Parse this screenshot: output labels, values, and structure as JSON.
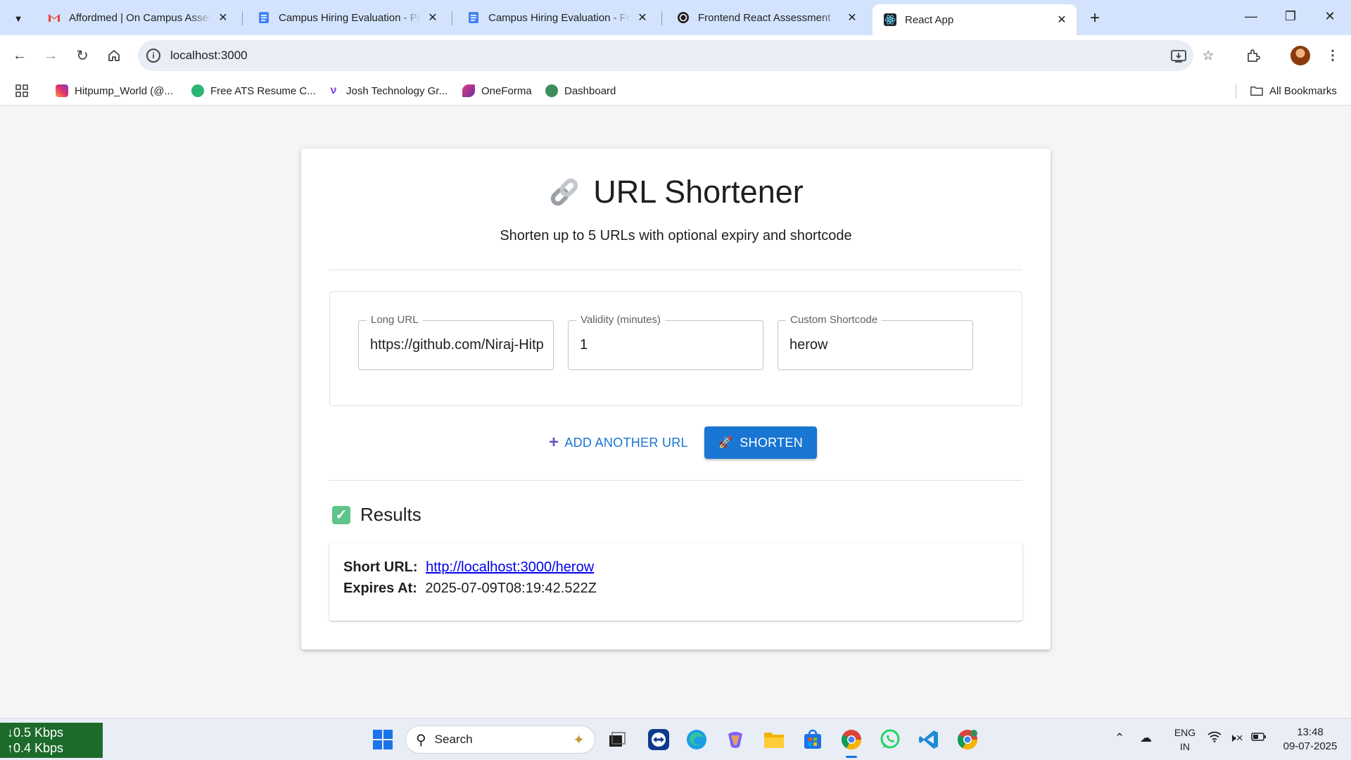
{
  "browser": {
    "tabs": [
      {
        "title": "Affordmed | On Campus Assessment",
        "favicon": "gmail-icon",
        "color": "#ea4335"
      },
      {
        "title": "Campus Hiring Evaluation - Pre-Test Setup",
        "favicon": "docs-icon",
        "color": "#4285f4"
      },
      {
        "title": "Campus Hiring Evaluation - Frontend",
        "favicon": "docs-icon",
        "color": "#4285f4"
      },
      {
        "title": "Frontend React Assessment",
        "favicon": "openai-icon",
        "color": "#1f1f1f"
      },
      {
        "title": "React App",
        "favicon": "react-icon",
        "color": "#61dafb"
      }
    ],
    "active_tab_index": 4,
    "address": "localhost:3000",
    "bookmarks": [
      {
        "label": "Hitpump_World (@...",
        "icon": "instagram-icon",
        "color": "#e1306c"
      },
      {
        "label": "Free ATS Resume C...",
        "icon": "resume-icon",
        "color": "#2bb673"
      },
      {
        "label": "Josh Technology Gr...",
        "icon": "josh-icon",
        "color": "#7b3fe4"
      },
      {
        "label": "OneForma",
        "icon": "oneforma-icon",
        "color": "#6b2fa0"
      },
      {
        "label": "Dashboard",
        "icon": "dashboard-icon",
        "color": "#3c8d5a"
      }
    ],
    "all_bookmarks_label": "All Bookmarks"
  },
  "app": {
    "title": "URL Shortener",
    "subtitle": "Shorten up to 5 URLs with optional expiry and shortcode",
    "fields": [
      {
        "label": "Long URL",
        "value": "https://github.com/Niraj-Hitpump"
      },
      {
        "label": "Validity (minutes)",
        "value": "1"
      },
      {
        "label": "Custom Shortcode",
        "value": "herow"
      }
    ],
    "add_button": "ADD ANOTHER URL",
    "shorten_button": "SHORTEN",
    "results_title": "Results",
    "result": {
      "short_url_label": "Short URL:",
      "short_url": "http://localhost:3000/herow",
      "expires_label": "Expires At:",
      "expires_at": "2025-07-09T08:19:42.522Z"
    },
    "accent_color": "#1976d2"
  },
  "taskbar": {
    "net_down": "0.5 Kbps",
    "net_up": "0.4 Kbps",
    "search_placeholder": "Search",
    "lang_top": "ENG",
    "lang_bottom": "IN",
    "time": "13:48",
    "date": "09-07-2025"
  }
}
